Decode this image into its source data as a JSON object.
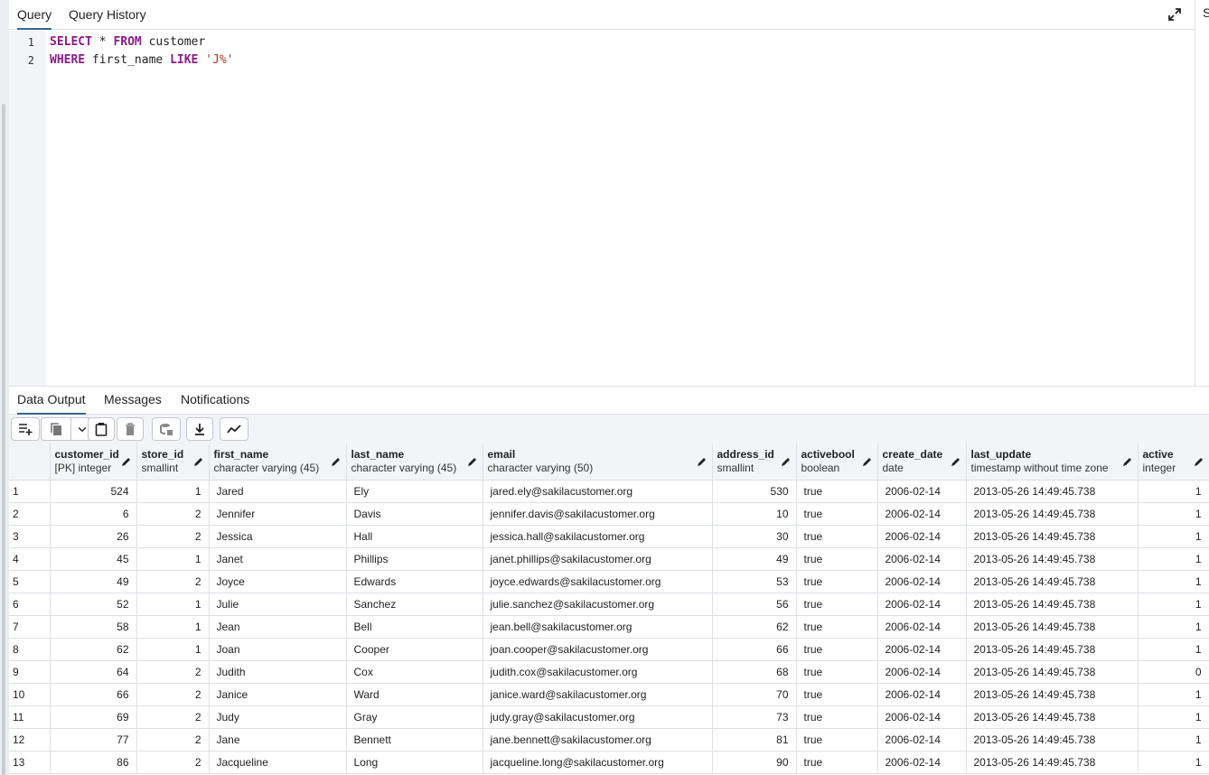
{
  "query_tabs": [
    {
      "label": "Query",
      "active": true
    },
    {
      "label": "Query History",
      "active": false
    }
  ],
  "right_tab_label": "S",
  "editor": {
    "lines": [
      {
        "num": "1",
        "parts": [
          {
            "t": "SELECT",
            "c": "kw"
          },
          {
            "t": " * ",
            "c": ""
          },
          {
            "t": "FROM",
            "c": "kw"
          },
          {
            "t": " customer",
            "c": ""
          }
        ]
      },
      {
        "num": "2",
        "parts": [
          {
            "t": "WHERE",
            "c": "kw"
          },
          {
            "t": " first_name ",
            "c": ""
          },
          {
            "t": "LIKE",
            "c": "kw"
          },
          {
            "t": " ",
            "c": ""
          },
          {
            "t": "'J%'",
            "c": "str"
          }
        ]
      }
    ]
  },
  "output_tabs": [
    {
      "label": "Data Output",
      "active": true
    },
    {
      "label": "Messages",
      "active": false
    },
    {
      "label": "Notifications",
      "active": false
    }
  ],
  "toolbar": {
    "buttons": [
      "add-row-icon",
      "copy-icon",
      "chevron-down-icon",
      "paste-icon",
      "delete-icon",
      "save-data-icon",
      "download-icon",
      "graph-icon"
    ]
  },
  "columns": [
    {
      "name": "customer_id",
      "type": "[PK] integer",
      "align": "right"
    },
    {
      "name": "store_id",
      "type": "smallint",
      "align": "right"
    },
    {
      "name": "first_name",
      "type": "character varying (45)",
      "align": "left"
    },
    {
      "name": "last_name",
      "type": "character varying (45)",
      "align": "left"
    },
    {
      "name": "email",
      "type": "character varying (50)",
      "align": "left"
    },
    {
      "name": "address_id",
      "type": "smallint",
      "align": "right"
    },
    {
      "name": "activebool",
      "type": "boolean",
      "align": "left"
    },
    {
      "name": "create_date",
      "type": "date",
      "align": "left"
    },
    {
      "name": "last_update",
      "type": "timestamp without time zone",
      "align": "left"
    },
    {
      "name": "active",
      "type": "integer",
      "align": "right"
    }
  ],
  "rows": [
    [
      "1",
      "524",
      "1",
      "Jared",
      "Ely",
      "jared.ely@sakilacustomer.org",
      "530",
      "true",
      "2006-02-14",
      "2013-05-26 14:49:45.738",
      "1"
    ],
    [
      "2",
      "6",
      "2",
      "Jennifer",
      "Davis",
      "jennifer.davis@sakilacustomer.org",
      "10",
      "true",
      "2006-02-14",
      "2013-05-26 14:49:45.738",
      "1"
    ],
    [
      "3",
      "26",
      "2",
      "Jessica",
      "Hall",
      "jessica.hall@sakilacustomer.org",
      "30",
      "true",
      "2006-02-14",
      "2013-05-26 14:49:45.738",
      "1"
    ],
    [
      "4",
      "45",
      "1",
      "Janet",
      "Phillips",
      "janet.phillips@sakilacustomer.org",
      "49",
      "true",
      "2006-02-14",
      "2013-05-26 14:49:45.738",
      "1"
    ],
    [
      "5",
      "49",
      "2",
      "Joyce",
      "Edwards",
      "joyce.edwards@sakilacustomer.org",
      "53",
      "true",
      "2006-02-14",
      "2013-05-26 14:49:45.738",
      "1"
    ],
    [
      "6",
      "52",
      "1",
      "Julie",
      "Sanchez",
      "julie.sanchez@sakilacustomer.org",
      "56",
      "true",
      "2006-02-14",
      "2013-05-26 14:49:45.738",
      "1"
    ],
    [
      "7",
      "58",
      "1",
      "Jean",
      "Bell",
      "jean.bell@sakilacustomer.org",
      "62",
      "true",
      "2006-02-14",
      "2013-05-26 14:49:45.738",
      "1"
    ],
    [
      "8",
      "62",
      "1",
      "Joan",
      "Cooper",
      "joan.cooper@sakilacustomer.org",
      "66",
      "true",
      "2006-02-14",
      "2013-05-26 14:49:45.738",
      "1"
    ],
    [
      "9",
      "64",
      "2",
      "Judith",
      "Cox",
      "judith.cox@sakilacustomer.org",
      "68",
      "true",
      "2006-02-14",
      "2013-05-26 14:49:45.738",
      "0"
    ],
    [
      "10",
      "66",
      "2",
      "Janice",
      "Ward",
      "janice.ward@sakilacustomer.org",
      "70",
      "true",
      "2006-02-14",
      "2013-05-26 14:49:45.738",
      "1"
    ],
    [
      "11",
      "69",
      "2",
      "Judy",
      "Gray",
      "judy.gray@sakilacustomer.org",
      "73",
      "true",
      "2006-02-14",
      "2013-05-26 14:49:45.738",
      "1"
    ],
    [
      "12",
      "77",
      "2",
      "Jane",
      "Bennett",
      "jane.bennett@sakilacustomer.org",
      "81",
      "true",
      "2006-02-14",
      "2013-05-26 14:49:45.738",
      "1"
    ],
    [
      "13",
      "86",
      "2",
      "Jacqueline",
      "Long",
      "jacqueline.long@sakilacustomer.org",
      "90",
      "true",
      "2006-02-14",
      "2013-05-26 14:49:45.738",
      "1"
    ]
  ]
}
